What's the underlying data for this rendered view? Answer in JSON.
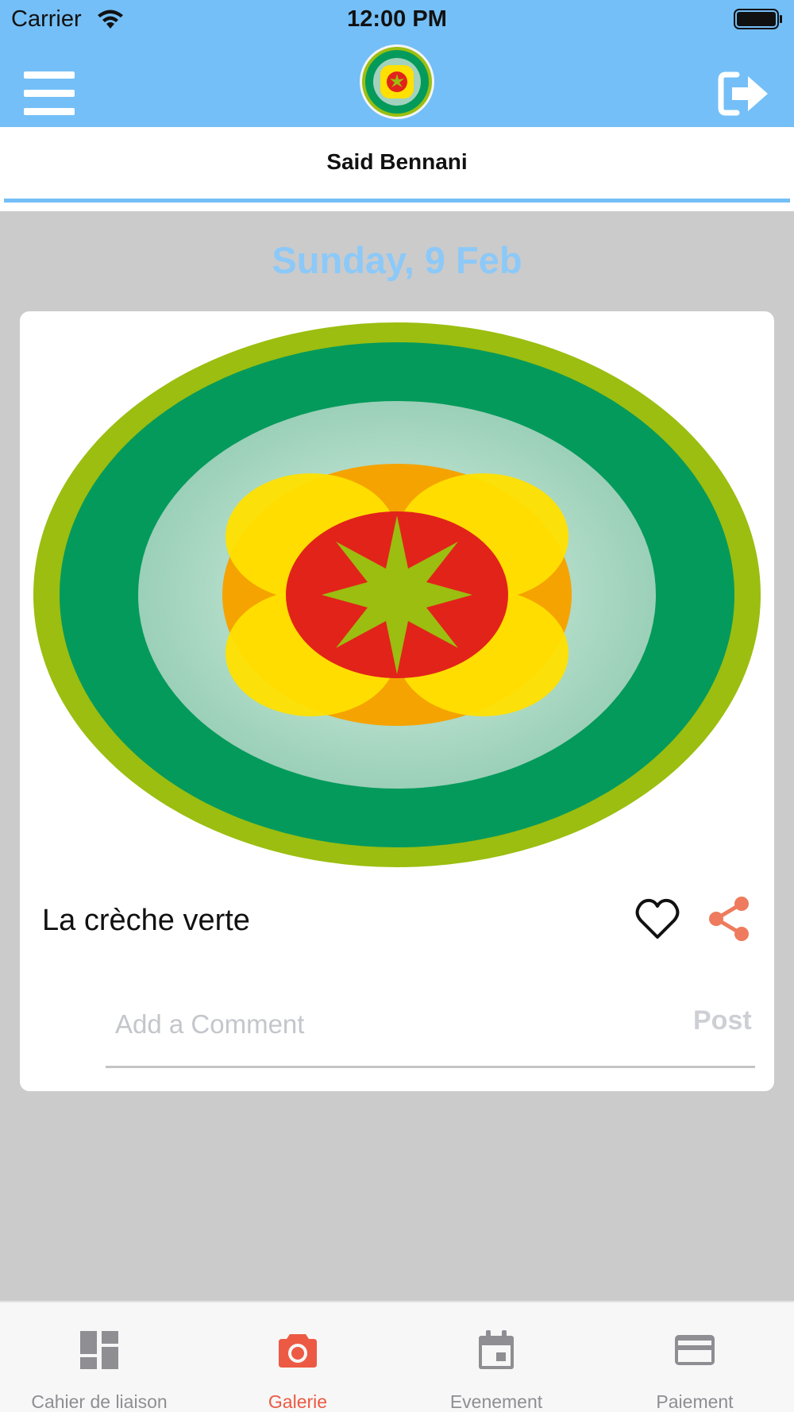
{
  "status_bar": {
    "carrier": "Carrier",
    "time": "12:00 PM"
  },
  "header": {
    "profile_name": "Said Bennani"
  },
  "feed": {
    "date": "Sunday, 9 Feb",
    "post": {
      "title": "La crèche verte",
      "comment_placeholder": "Add a Comment",
      "post_label": "Post"
    }
  },
  "tab_bar": {
    "tabs": [
      {
        "label": "Cahier de liaison",
        "icon": "dashboard-icon"
      },
      {
        "label": "Galerie",
        "icon": "camera-icon",
        "active": true
      },
      {
        "label": "Evenement",
        "icon": "calendar-icon"
      },
      {
        "label": "Paiement",
        "icon": "credit-card-icon"
      }
    ]
  },
  "colors": {
    "accent": "#74bff7",
    "active_tab": "#ec5a43",
    "inactive_tab": "#8e8e93",
    "background": "#cbcbcb"
  }
}
